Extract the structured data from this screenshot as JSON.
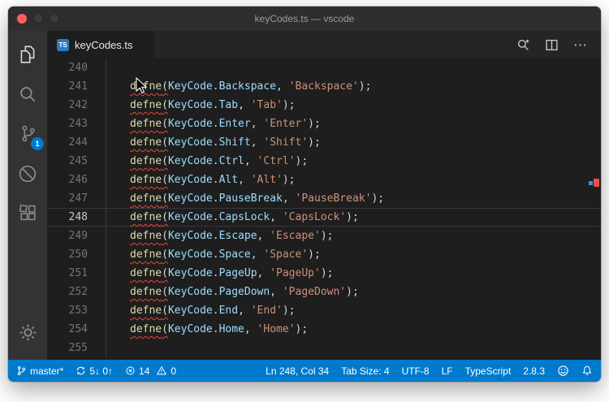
{
  "window": {
    "title": "keyCodes.ts — vscode"
  },
  "tab_bar": {
    "active_tab": {
      "label": "keyCodes.ts",
      "icon": "TS"
    },
    "actions": {
      "more": "⋯"
    }
  },
  "activity_bar": {
    "scm_badge": "1"
  },
  "editor": {
    "function_name": "defne",
    "syntax": {
      "open": "(",
      "separator": ", ",
      "close": ");"
    },
    "lines": [
      {
        "num": "240",
        "empty": true
      },
      {
        "num": "241",
        "key": "KeyCode.Backspace",
        "label": "'Backspace'"
      },
      {
        "num": "242",
        "key": "KeyCode.Tab",
        "label": "'Tab'"
      },
      {
        "num": "243",
        "key": "KeyCode.Enter",
        "label": "'Enter'"
      },
      {
        "num": "244",
        "key": "KeyCode.Shift",
        "label": "'Shift'"
      },
      {
        "num": "245",
        "key": "KeyCode.Ctrl",
        "label": "'Ctrl'"
      },
      {
        "num": "246",
        "key": "KeyCode.Alt",
        "label": "'Alt'"
      },
      {
        "num": "247",
        "key": "KeyCode.PauseBreak",
        "label": "'PauseBreak'"
      },
      {
        "num": "248",
        "key": "KeyCode.CapsLock",
        "label": "'CapsLock'",
        "current": true
      },
      {
        "num": "249",
        "key": "KeyCode.Escape",
        "label": "'Escape'"
      },
      {
        "num": "250",
        "key": "KeyCode.Space",
        "label": "'Space'"
      },
      {
        "num": "251",
        "key": "KeyCode.PageUp",
        "label": "'PageUp'"
      },
      {
        "num": "252",
        "key": "KeyCode.PageDown",
        "label": "'PageDown'"
      },
      {
        "num": "253",
        "key": "KeyCode.End",
        "label": "'End'"
      },
      {
        "num": "254",
        "key": "KeyCode.Home",
        "label": "'Home'"
      },
      {
        "num": "255",
        "empty": true
      }
    ]
  },
  "status_bar": {
    "branch": "master*",
    "sync": "5↓ 0↑",
    "errors": "14",
    "warnings": "0",
    "cursor": "Ln 248, Col 34",
    "tab_size": "Tab Size: 4",
    "encoding": "UTF-8",
    "eol": "LF",
    "language": "TypeScript",
    "version": "2.8.3"
  },
  "colors": {
    "status_bg": "#007acc",
    "editor_bg": "#1e1e1e",
    "function": "#dcdcaa",
    "variable": "#9cdcfe",
    "string": "#ce9178",
    "punctuation": "#d4d4d4",
    "squiggle": "#e8453c",
    "badge": "#007acc"
  }
}
